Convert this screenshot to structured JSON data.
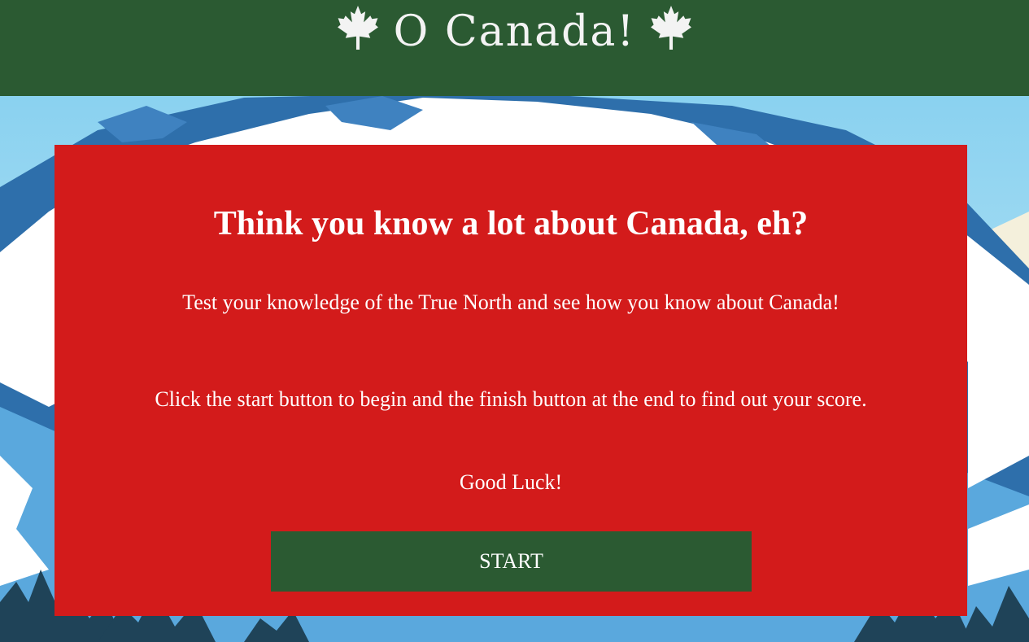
{
  "header": {
    "title": "O Canada!",
    "icon_left": "maple-leaf-icon",
    "icon_right": "maple-leaf-icon",
    "background_color": "#2b5a32"
  },
  "card": {
    "heading": "Think you know a lot about Canada, eh?",
    "intro": "Test your knowledge of the True North and see how you know about Canada!",
    "instructions": "Click the start button to begin and the finish button at the end to find out your score.",
    "luck": "Good Luck!",
    "start_label": "START",
    "background_color": "#d31b1b",
    "button_color": "#2b5a32"
  }
}
